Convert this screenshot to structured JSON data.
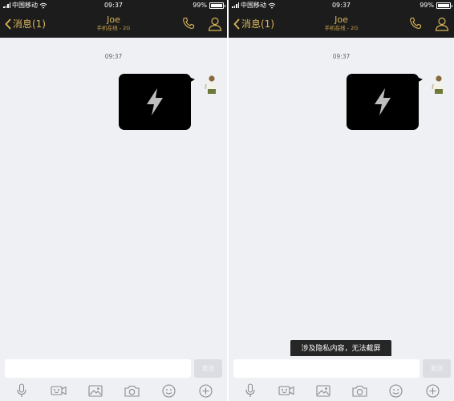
{
  "status_bar": {
    "carrier": "中国移动",
    "time": "09:37",
    "battery": "99%",
    "battery_level": 0.99
  },
  "nav": {
    "back_label": "消息(1)",
    "title": "Joe",
    "subtitle": "手机在线 - 2G"
  },
  "chat": {
    "timestamp": "09:37"
  },
  "input": {
    "send_label": "发送"
  },
  "toast": {
    "text": "涉及隐私内容，无法截屏"
  },
  "toolbar": {
    "icons": [
      "microphone-icon",
      "video-icon",
      "image-icon",
      "camera-icon",
      "emoji-icon",
      "plus-icon"
    ]
  },
  "colors": {
    "header_bg": "#1c1c1c",
    "accent_gold": "#d9b55a",
    "chat_bg": "#eff0f4",
    "bubble": "#000000"
  }
}
